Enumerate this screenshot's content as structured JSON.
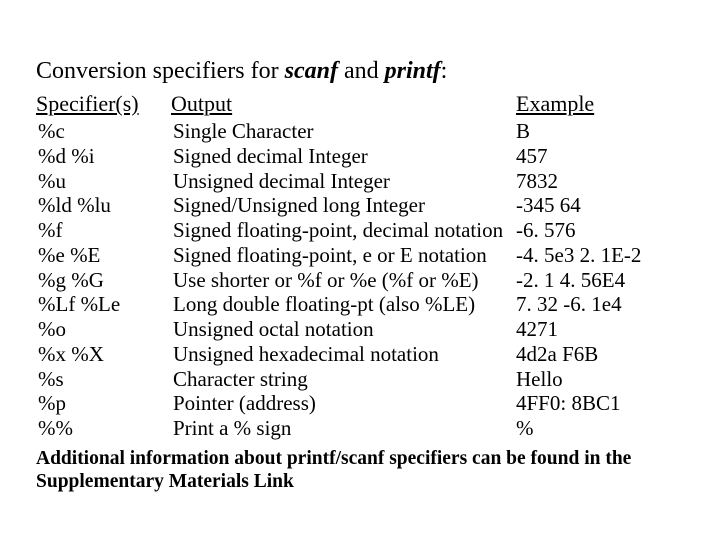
{
  "title": {
    "pre": "Conversion specifiers for ",
    "kw1": "scanf",
    "mid": " and ",
    "kw2": "printf",
    "post": ":"
  },
  "headers": {
    "spec": "Specifier(s)",
    "out": "Output",
    "ex": "Example"
  },
  "rows": [
    {
      "spec": "%c",
      "out": "Single Character",
      "ex": " B"
    },
    {
      "spec": "%d  %i",
      "out": "Signed decimal Integer",
      "ex": " 457"
    },
    {
      "spec": "%u",
      "out": "Unsigned decimal Integer",
      "ex": " 7832"
    },
    {
      "spec": "%ld  %lu",
      "out": "Signed/Unsigned long Integer",
      "ex": "-345   64"
    },
    {
      "spec": "%f",
      "out": "Signed floating-point, decimal notation",
      "ex": "-6. 576"
    },
    {
      "spec": "%e  %E",
      "out": "Signed floating-point, e or E  notation",
      "ex": "-4. 5e3  2. 1E-2"
    },
    {
      "spec": "%g  %G",
      "out": "Use shorter or %f  or  %e  (%f  or  %E)",
      "ex": "-2. 1   4. 56E4"
    },
    {
      "spec": "%Lf  %Le",
      "out": "Long double floating-pt  (also %LE)",
      "ex": " 7. 32  -6. 1e4"
    },
    {
      "spec": "%o",
      "out": "Unsigned octal notation",
      "ex": " 4271"
    },
    {
      "spec": "%x  %X",
      "out": "Unsigned hexadecimal notation",
      "ex": " 4d2a  F6B"
    },
    {
      "spec": "%s",
      "out": "Character string",
      "ex": " Hello"
    },
    {
      "spec": "%p",
      "out": "Pointer (address)",
      "ex": " 4FF0: 8BC1"
    },
    {
      "spec": "%%",
      "out": "Print a % sign",
      "ex": "  %"
    }
  ],
  "footer": "Additional information about printf/scanf specifiers can be found in the Supplementary Materials Link"
}
